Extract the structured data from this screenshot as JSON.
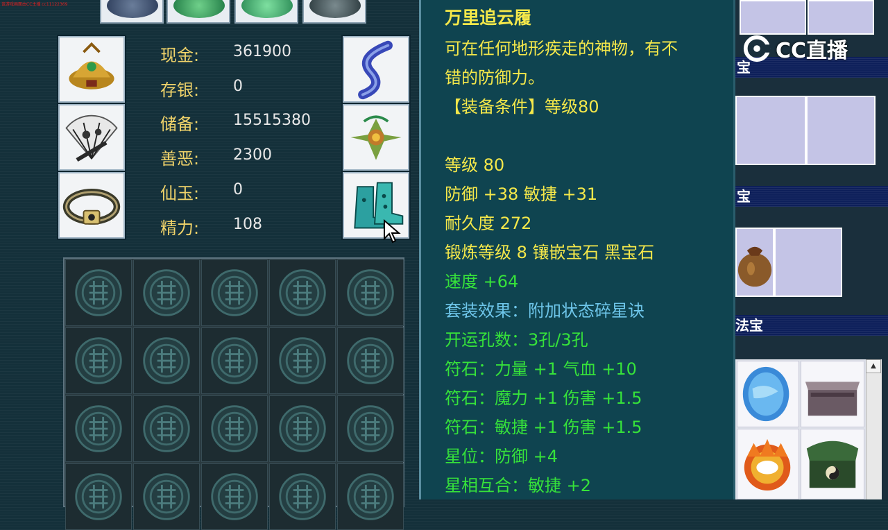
{
  "overlay_text": "该游戏画面由CC主播 cc11122369",
  "watermark": {
    "logo_text": "CC直播"
  },
  "stats": [
    {
      "label": "现金:",
      "value": "361900"
    },
    {
      "label": "存银:",
      "value": "0"
    },
    {
      "label": "储备:",
      "value": "15515380"
    },
    {
      "label": "善恶:",
      "value": "2300"
    },
    {
      "label": "仙玉:",
      "value": "0"
    },
    {
      "label": "精力:",
      "value": "108"
    }
  ],
  "equipment_left": [
    "helmet-icon",
    "fan-weapon-icon",
    "belt-icon"
  ],
  "equipment_right": [
    "ribbon-icon",
    "necklace-icon",
    "boots-icon"
  ],
  "tooltip": {
    "name": "万里追云履",
    "desc_line1": "可在任何地形疾走的神物，有不",
    "desc_line2": "错的防御力。",
    "requirement": "【装备条件】等级80",
    "level": "等级 80",
    "defense": "防御 +38 敏捷 +31",
    "durability": "耐久度 272",
    "forge": "锻炼等级 8 镶嵌宝石 黑宝石",
    "speed": "速度 +64",
    "set_effect": "套装效果：附加状态碎星诀",
    "slots": "开运孔数：3孔/3孔",
    "rune1": "符石：力量 +1 气血 +10",
    "rune2": "符石：魔力 +1 伤害 +1.5",
    "rune3": "符石：敏捷 +1 伤害 +1.5",
    "star": "星位：防御 +4",
    "star_combo": "星相互合：敏捷 +2"
  },
  "right_panel": {
    "band1": "宝",
    "band2": "宝",
    "band3": "法宝"
  },
  "colors": {
    "tooltip_bg": "#0f4450",
    "title_yellow": "#f5e84a",
    "attr_green": "#36e23a",
    "set_blue": "#6ec6ea",
    "stat_label": "#f0d36a"
  }
}
